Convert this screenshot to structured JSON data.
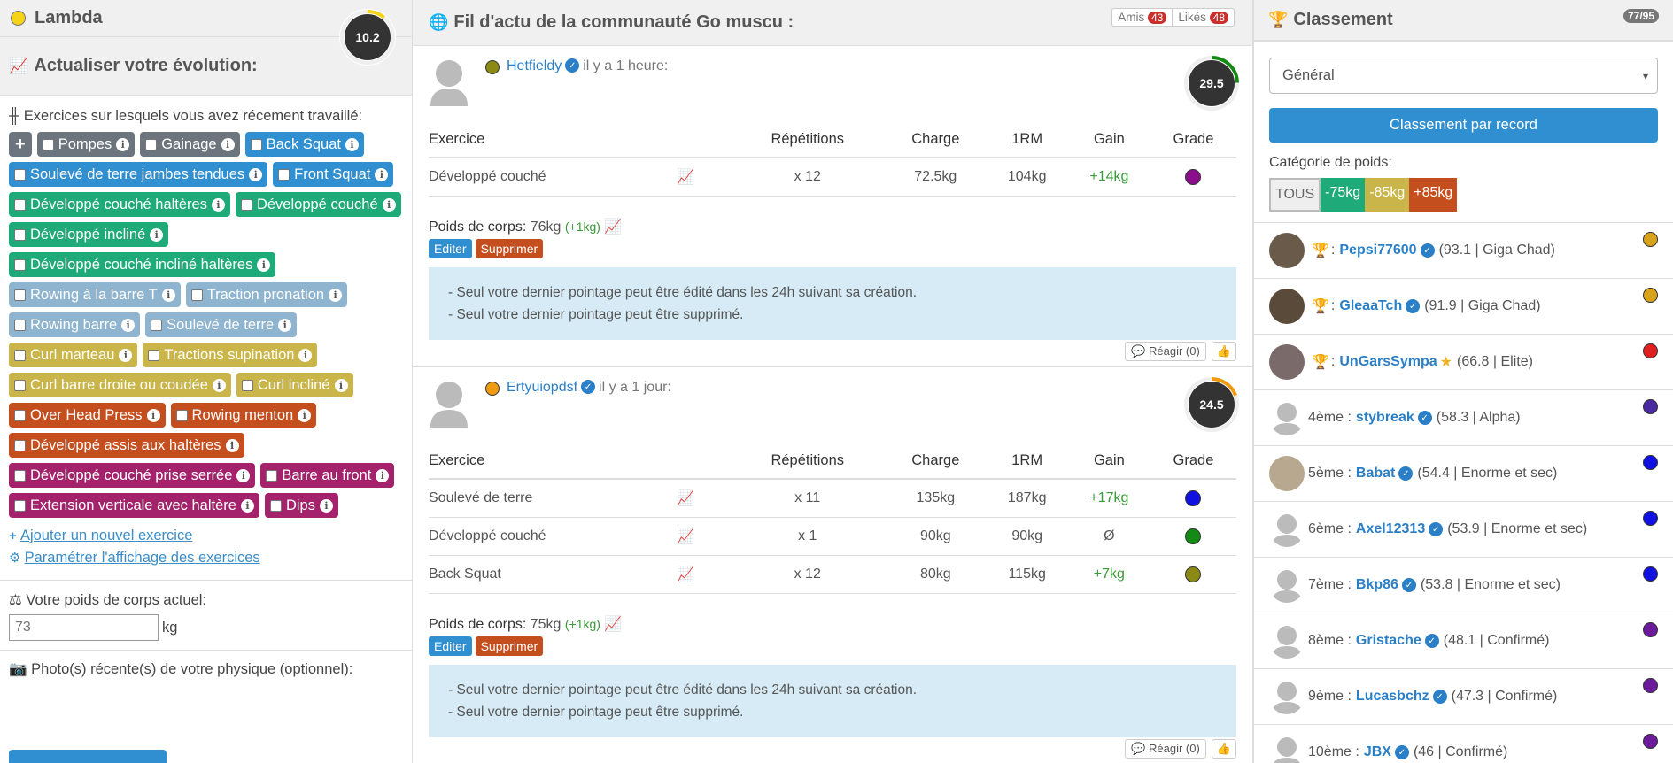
{
  "left": {
    "user_name": "Lambda",
    "user_score": "10.2",
    "update_title": "Actualiser votre évolution:",
    "recent_label": "Exercices sur lesquels vous avez récement travaillé:",
    "exercises": [
      {
        "label": "Pompes",
        "color": "gray"
      },
      {
        "label": "Gainage",
        "color": "gray"
      },
      {
        "label": "Back Squat",
        "color": "blue"
      },
      {
        "label": "Soulevé de terre jambes tendues",
        "color": "blue"
      },
      {
        "label": "Front Squat",
        "color": "blue"
      },
      {
        "label": "Développé couché haltères",
        "color": "green"
      },
      {
        "label": "Développé couché",
        "color": "green"
      },
      {
        "label": "Développé incliné",
        "color": "green"
      },
      {
        "label": "Développé couché incliné haltères",
        "color": "green"
      },
      {
        "label": "Rowing à la barre T",
        "color": "lblue"
      },
      {
        "label": "Traction pronation",
        "color": "lblue"
      },
      {
        "label": "Rowing barre",
        "color": "lblue"
      },
      {
        "label": "Soulevé de terre",
        "color": "lblue"
      },
      {
        "label": "Curl marteau",
        "color": "yellow"
      },
      {
        "label": "Tractions supination",
        "color": "yellow"
      },
      {
        "label": "Curl barre droite ou coudée",
        "color": "yellow"
      },
      {
        "label": "Curl incliné",
        "color": "yellow"
      },
      {
        "label": "Over Head Press",
        "color": "orange"
      },
      {
        "label": "Rowing menton",
        "color": "orange"
      },
      {
        "label": "Développé assis aux haltères",
        "color": "orange"
      },
      {
        "label": "Développé couché prise serrée",
        "color": "purple"
      },
      {
        "label": "Barre au front",
        "color": "purple"
      },
      {
        "label": "Extension verticale avec haltère",
        "color": "purple"
      },
      {
        "label": "Dips",
        "color": "purple"
      }
    ],
    "add_exercise": "Ajouter un nouvel exercice",
    "settings_link": "Paramétrer l'affichage des exercices",
    "weight_label": "Votre poids de corps actuel:",
    "weight_placeholder": "73",
    "weight_unit": "kg",
    "photo_label": "Photo(s) récente(s) de votre physique (optionnel):"
  },
  "mid": {
    "title": "Fil d'actu de la communauté Go muscu :",
    "friends_label": "Amis",
    "friends_count": "43",
    "likes_label": "Likés",
    "likes_count": "48",
    "columns": [
      "Exercice",
      "Répétitions",
      "Charge",
      "1RM",
      "Gain",
      "Grade"
    ],
    "posts": [
      {
        "user": "Hetfieldy",
        "time": "il y a 1 heure:",
        "score": "29.5",
        "rows": [
          {
            "ex": "Développé couché",
            "reps": "x 12",
            "charge": "72.5kg",
            "rm": "104kg",
            "gain": "+14kg",
            "grade": "#8b0f8b"
          }
        ],
        "bw_label": "Poids de corps:",
        "bw_value": "76kg",
        "bw_gain": "(+1kg)",
        "edit": "Editer",
        "delete": "Supprimer",
        "info1": "- Seul votre dernier pointage peut être édité dans les 24h suivant sa création.",
        "info2": "- Seul votre dernier pointage peut être supprimé.",
        "react": "Réagir (0)"
      },
      {
        "user": "Ertyuiopdsf",
        "time": "il y a 1 jour:",
        "score": "24.5",
        "rows": [
          {
            "ex": "Soulevé de terre",
            "reps": "x 11",
            "charge": "135kg",
            "rm": "187kg",
            "gain": "+17kg",
            "grade": "#1010e0"
          },
          {
            "ex": "Développé couché",
            "reps": "x 1",
            "charge": "90kg",
            "rm": "90kg",
            "gain": "Ø",
            "grade": "#138a13"
          },
          {
            "ex": "Back Squat",
            "reps": "x 12",
            "charge": "80kg",
            "rm": "115kg",
            "gain": "+7kg",
            "grade": "#8a8a15"
          }
        ],
        "bw_label": "Poids de corps:",
        "bw_value": "75kg",
        "bw_gain": "(+1kg)",
        "edit": "Editer",
        "delete": "Supprimer",
        "info1": "- Seul votre dernier pointage peut être édité dans les 24h suivant sa création.",
        "info2": "- Seul votre dernier pointage peut être supprimé.",
        "react": "Réagir (0)"
      }
    ]
  },
  "right": {
    "title": "Classement",
    "counter": "77/95",
    "select_value": "Général",
    "record_button": "Classement par record",
    "weight_cat_label": "Catégorie de poids:",
    "cats": [
      "TOUS",
      "-75kg",
      "-85kg",
      "+85kg"
    ],
    "rankings": [
      {
        "rank": "",
        "name": "Pepsi77600",
        "info": "(93.1 | Giga Chad)",
        "badge": "#d9a21b"
      },
      {
        "rank": "",
        "name": "GleaaTch",
        "info": "(91.9 | Giga Chad)",
        "badge": "#d9a21b"
      },
      {
        "rank": "",
        "name": "UnGarsSympa",
        "info": "(66.8 | Elite)",
        "badge": "#e02020"
      },
      {
        "rank": "4ème :",
        "name": "stybreak",
        "info": "(58.3 | Alpha)",
        "badge": "#4a2aa0"
      },
      {
        "rank": "5ème :",
        "name": "Babat",
        "info": "(54.4 | Enorme et sec)",
        "badge": "#1010e0"
      },
      {
        "rank": "6ème :",
        "name": "Axel12313",
        "info": "(53.9 | Enorme et sec)",
        "badge": "#1010e0"
      },
      {
        "rank": "7ème :",
        "name": "Bkp86",
        "info": "(53.8 | Enorme et sec)",
        "badge": "#1010e0"
      },
      {
        "rank": "8ème :",
        "name": "Gristache",
        "info": "(48.1 | Confirmé)",
        "badge": "#6a1a9a"
      },
      {
        "rank": "9ème :",
        "name": "Lucasbchz",
        "info": "(47.3 | Confirmé)",
        "badge": "#6a1a9a"
      },
      {
        "rank": "10ème :",
        "name": "JBX",
        "info": "(46 | Confirmé)",
        "badge": "#6a1a9a"
      }
    ]
  }
}
